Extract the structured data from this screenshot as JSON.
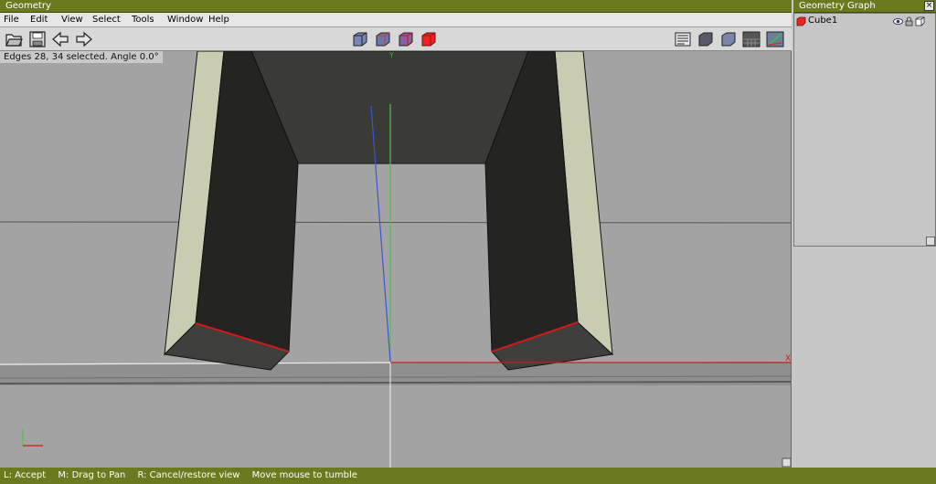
{
  "window": {
    "title": "Geometry"
  },
  "menu": [
    "File",
    "Edit",
    "View",
    "Select",
    "Tools",
    "Window",
    "Help"
  ],
  "toolbar": {
    "left_icons": [
      "open-folder-icon",
      "save-icon",
      "back-arrow-icon",
      "forward-arrow-icon"
    ],
    "center_icons": [
      "wireframe-cube-icon",
      "hidden-line-cube-icon",
      "shaded-wire-cube-icon",
      "solid-red-cube-icon"
    ],
    "right_icons": [
      "display-options-icon",
      "smooth-shade-icon",
      "flat-shade-icon",
      "grid-toggle-icon",
      "axis-toggle-icon"
    ]
  },
  "viewport": {
    "status": "Edges 28, 34 selected. Angle 0.0°",
    "axis_y_label": "Y",
    "axis_x_label": "X",
    "colors": {
      "background": "#a3a3a3",
      "dark_face": "#242422",
      "top_face": "#3a3a36",
      "light_face": "#c9ccb0",
      "selected_edge": "#d11a1a"
    }
  },
  "graph": {
    "title": "Geometry Graph",
    "items": [
      {
        "label": "Cube1",
        "icon": "red-cube-icon"
      }
    ]
  },
  "statusbar": {
    "hints": [
      "L: Accept",
      "M: Drag to Pan",
      "R: Cancel/restore view",
      "Move mouse to tumble"
    ]
  },
  "colors": {
    "titlebar": "#6b7a1e",
    "accent_red": "#d11a1a"
  }
}
